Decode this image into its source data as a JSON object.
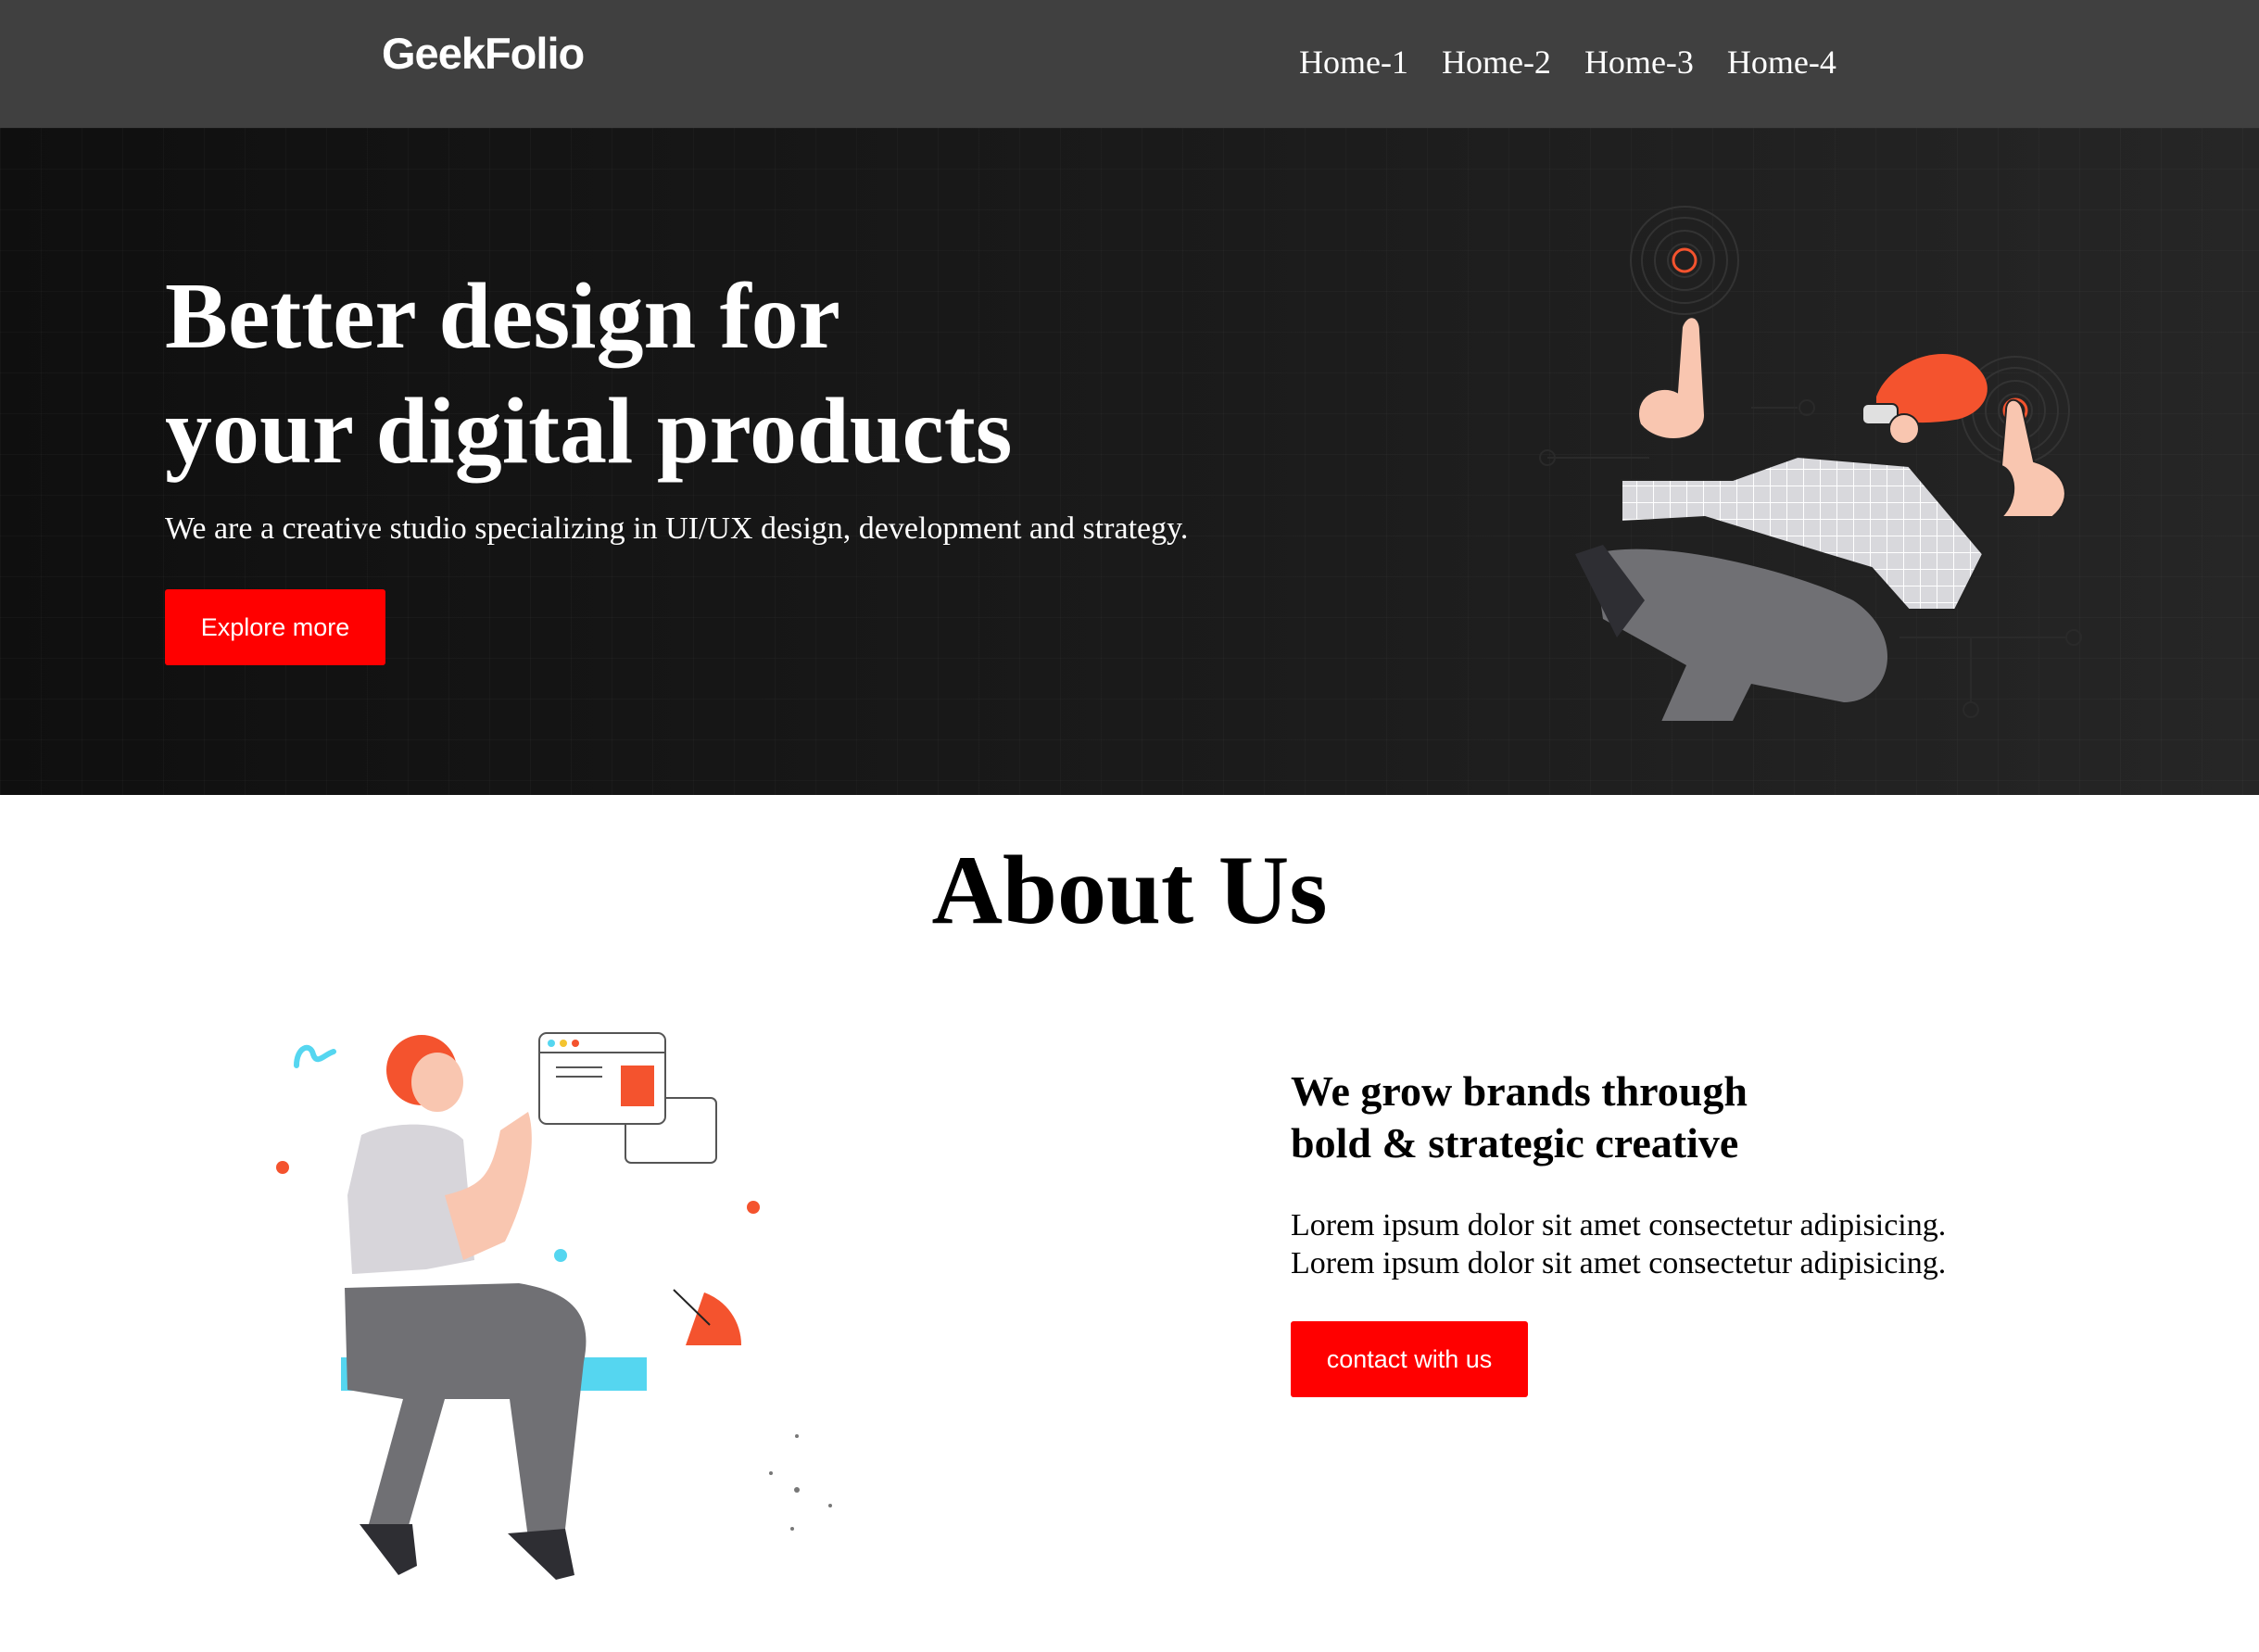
{
  "navbar": {
    "brand": "GeekFolio",
    "links": [
      "Home-1",
      "Home-2",
      "Home-3",
      "Home-4"
    ]
  },
  "hero": {
    "title_line1": "Better design for",
    "title_line2": "your digital products",
    "subtitle": "We are a creative studio specializing in UI/UX design, development and strategy.",
    "button_label": "Explore more"
  },
  "about": {
    "title": "About Us",
    "heading_line1": "We grow brands through",
    "heading_line2": "bold & strategic creative",
    "body_line1": "Lorem ipsum dolor sit amet consectetur adipisicing.",
    "body_line2": "Lorem ipsum dolor sit amet consectetur adipisicing.",
    "button_label": "contact with us"
  },
  "colors": {
    "navbar_bg": "#404040",
    "hero_bg": "#1a1a1a",
    "accent_red": "#ff0000",
    "illustration_orange": "#f4532e",
    "illustration_cyan": "#55d6f0"
  }
}
